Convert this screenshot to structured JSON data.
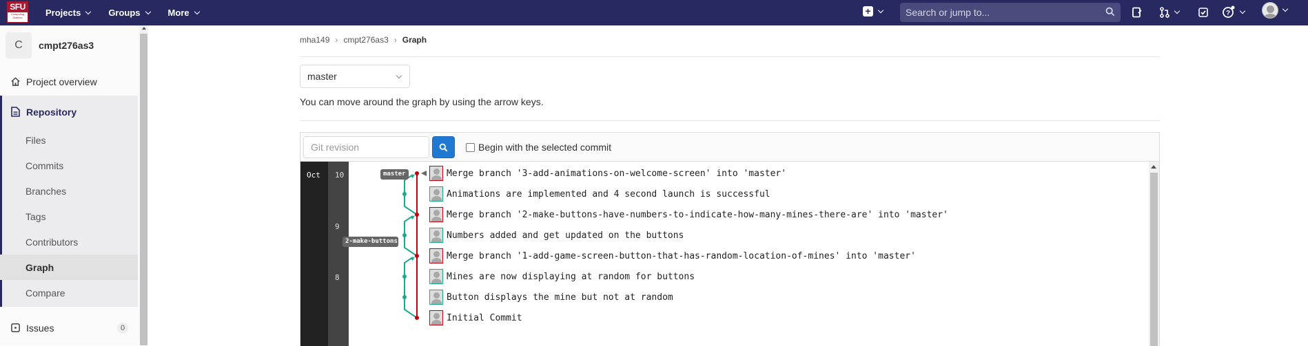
{
  "navbar": {
    "logo_text": "SFU",
    "logo_subtext": "Computing Science",
    "menu": [
      {
        "label": "Projects"
      },
      {
        "label": "Groups"
      },
      {
        "label": "More"
      }
    ],
    "search_placeholder": "Search or jump to...",
    "bg_color": "#292961"
  },
  "sidebar": {
    "project_avatar": "C",
    "project_name": "cmpt276as3",
    "project_overview": "Project overview",
    "repository": "Repository",
    "repo_items": [
      "Files",
      "Commits",
      "Branches",
      "Tags",
      "Contributors",
      "Graph",
      "Compare"
    ],
    "active_item": "Graph",
    "issues": "Issues",
    "issues_count": "0"
  },
  "breadcrumb": {
    "items": [
      "mha149",
      "cmpt276as3",
      "Graph"
    ]
  },
  "branch_select": {
    "value": "master"
  },
  "hint": "You can move around the graph by using the arrow keys.",
  "graph_toolbar": {
    "revision_placeholder": "Git revision",
    "checkbox_label": "Begin with the selected commit",
    "checkbox_checked": false
  },
  "graph": {
    "month": "Oct",
    "days": [
      "10",
      "9",
      "8"
    ],
    "refs": [
      "master",
      "2-make-buttons-…"
    ],
    "commits": [
      {
        "message": "Merge branch '3-add-animations-on-welcome-screen' into 'master'",
        "merge": true
      },
      {
        "message": "Animations are implemented and 4 second launch is successful",
        "merge": false
      },
      {
        "message": "Merge branch '2-make-buttons-have-numbers-to-indicate-how-many-mines-there-are' into 'master'",
        "merge": true
      },
      {
        "message": "Numbers added and get updated on the buttons",
        "merge": false
      },
      {
        "message": "Merge branch '1-add-game-screen-button-that-has-random-location-of-mines' into 'master'",
        "merge": true
      },
      {
        "message": "Mines are now displaying at random for buttons",
        "merge": false
      },
      {
        "message": "Button displays the mine but not at random",
        "merge": false
      },
      {
        "message": "Initial Commit",
        "merge": true
      }
    ],
    "colors": {
      "master_line": "#c0000c",
      "branch_line": "#1aaa8a"
    }
  }
}
